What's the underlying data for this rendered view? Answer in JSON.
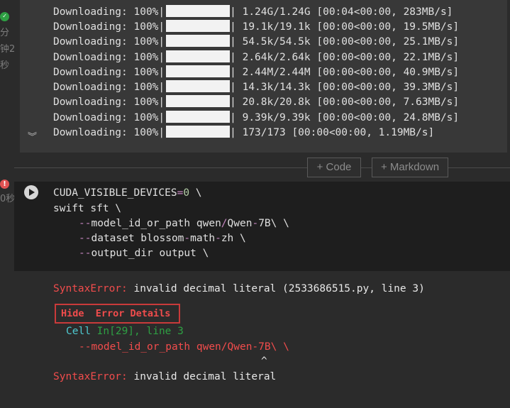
{
  "gutter": {
    "ok_frag1": "分",
    "ok_frag2": "钟2",
    "ok_frag3": "秒",
    "err_frag": "0秒"
  },
  "downloads": [
    {
      "label": "Downloading: 100%|",
      "stats": "| 1.24G/1.24G [00:04<00:00, 283MB/s]"
    },
    {
      "label": "Downloading: 100%|",
      "stats": "| 19.1k/19.1k [00:00<00:00, 19.5MB/s]"
    },
    {
      "label": "Downloading: 100%|",
      "stats": "| 54.5k/54.5k [00:00<00:00, 25.1MB/s]"
    },
    {
      "label": "Downloading: 100%|",
      "stats": "| 2.64k/2.64k [00:00<00:00, 22.1MB/s]"
    },
    {
      "label": "Downloading: 100%|",
      "stats": "| 2.44M/2.44M [00:00<00:00, 40.9MB/s]"
    },
    {
      "label": "Downloading: 100%|",
      "stats": "| 14.3k/14.3k [00:00<00:00, 39.3MB/s]"
    },
    {
      "label": "Downloading: 100%|",
      "stats": "| 20.8k/20.8k [00:00<00:00, 7.63MB/s]"
    },
    {
      "label": "Downloading: 100%|",
      "stats": "| 9.39k/9.39k [00:00<00:00, 24.8MB/s]"
    },
    {
      "label": "Downloading: 100%|",
      "stats": "| 173/173 [00:00<00:00, 1.19MB/s]"
    }
  ],
  "download_progress": 1.0,
  "toolbar": {
    "add_code": "+ Code",
    "add_markdown": "+ Markdown"
  },
  "code": {
    "l1_a": "CUDA_VISIBLE_DEVICES",
    "l1_op": "=",
    "l1_num": "0",
    "l1_b": " \\",
    "l2": "swift sft \\",
    "l3_op": "--",
    "l3_a": "model_id_or_path qwen",
    "l3_op2": "/",
    "l3_b": "Qwen",
    "l3_op3": "-",
    "l3_c": "7B\\ \\",
    "l4_op": "--",
    "l4_a": "dataset blossom",
    "l4_op2": "-",
    "l4_b": "math",
    "l4_op3": "-",
    "l4_c": "zh \\",
    "l5_op": "--",
    "l5_a": "output_dir output \\"
  },
  "error": {
    "name": "SyntaxError:",
    "message": " invalid decimal literal (2533686515.py, line 3)",
    "hide_button": "Hide  Error Details",
    "trace_cell": "Cell ",
    "trace_in": "In[29], line 3",
    "trace_code": "--model_id_or_path qwen/Qwen-7B\\ \\",
    "caret": "^",
    "final_name": "SyntaxError:",
    "final_message": " invalid decimal literal"
  },
  "colors": {
    "error": "#f14c4c",
    "success": "#2ea043",
    "cyan": "#4ec9d0",
    "operator": "#c586c0"
  }
}
